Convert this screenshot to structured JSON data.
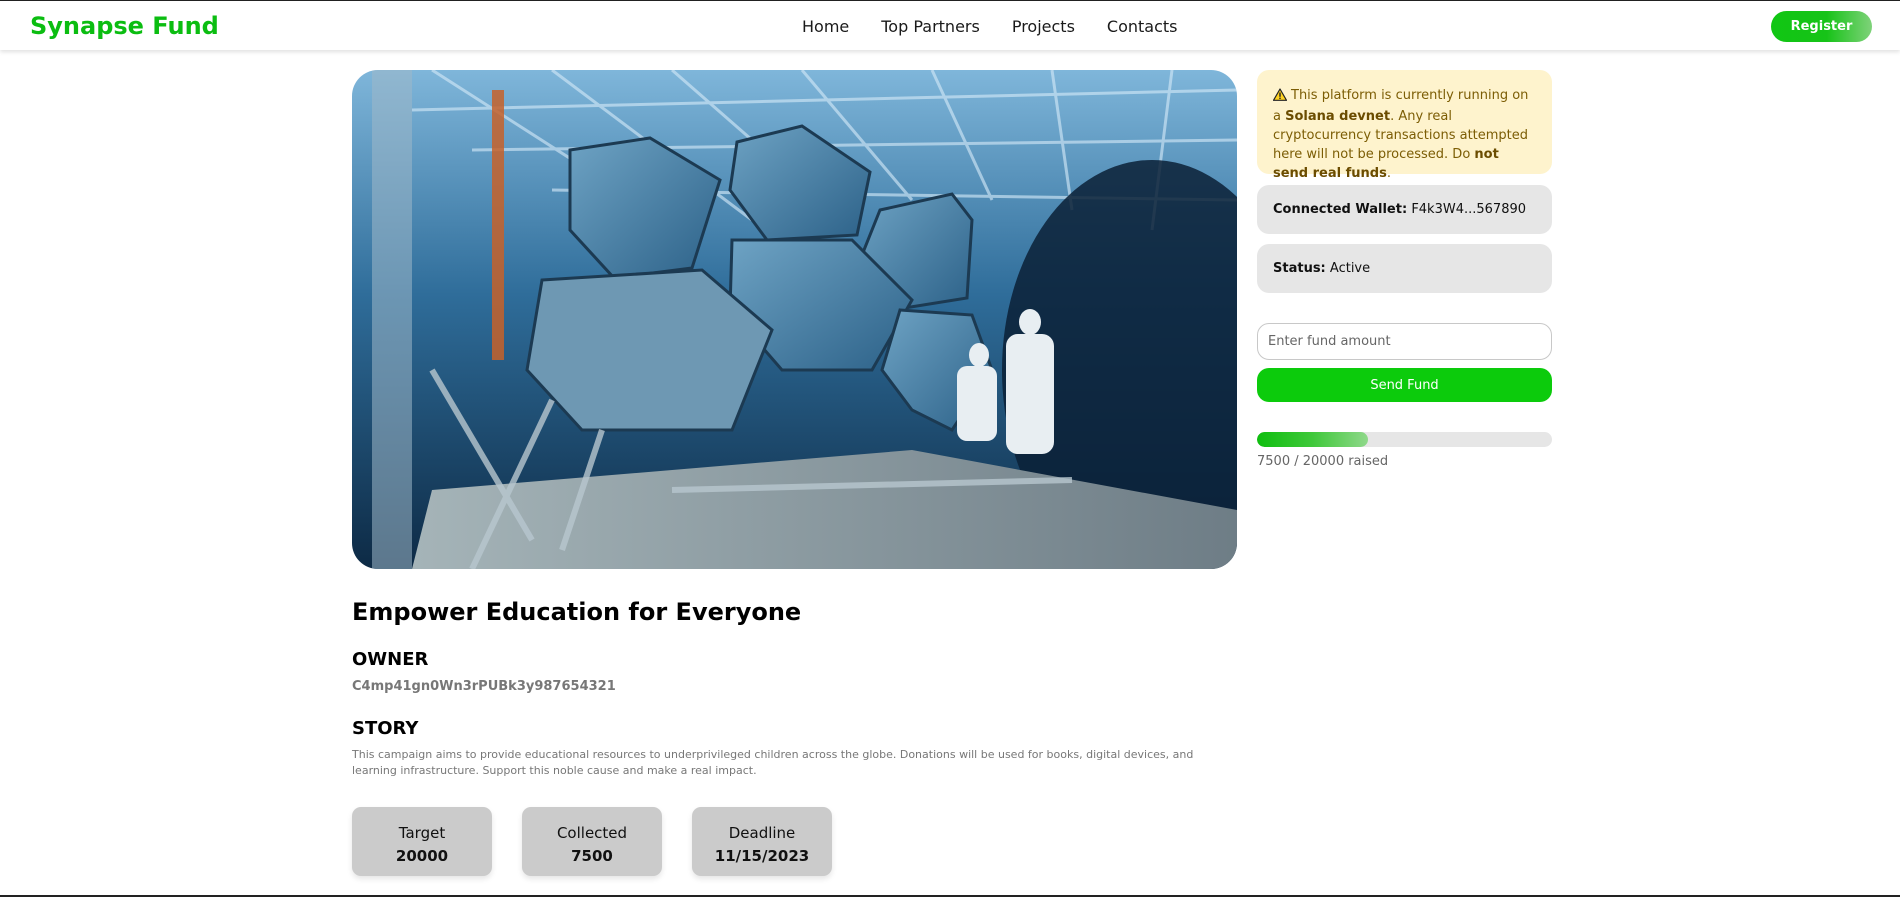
{
  "navbar": {
    "brand": "Synapse Fund",
    "links": [
      "Home",
      "Top Partners",
      "Projects",
      "Contacts"
    ],
    "register_label": "Register"
  },
  "project": {
    "title": "Empower Education for Everyone",
    "owner_heading": "OWNER",
    "owner": "C4mp41gn0Wn3rPUBk3y987654321",
    "story_heading": "STORY",
    "story": "This campaign aims to provide educational resources to underprivileged children across the globe. Donations will be used for books, digital devices, and learning infrastructure. Support this noble cause and make a real impact.",
    "stats": [
      {
        "label": "Target",
        "value": "20000"
      },
      {
        "label": "Collected",
        "value": "7500"
      },
      {
        "label": "Deadline",
        "value": "11/15/2023"
      }
    ]
  },
  "sidebar": {
    "warning": {
      "pre": "This platform is currently running on a ",
      "network": "Solana devnet",
      "mid": ". Any real cryptocurrency transactions attempted here will not be processed. Do ",
      "emphasis": "not send real funds",
      "post": "."
    },
    "wallet_key": "Connected Wallet:",
    "wallet_value": "F4k3W4...567890",
    "status_key": "Status:",
    "status_value": "Active",
    "fund_placeholder": "Enter fund amount",
    "send_label": "Send Fund",
    "progress_fraction": 0.375,
    "progress_text": "7500 / 20000 raised"
  },
  "colors": {
    "brand": "#0bbd11",
    "send_button": "#0ccb0c",
    "warning_bg": "#fef3cd",
    "card_bg": "#cbcbcb"
  },
  "icons": {
    "warning": "warning-triangle-icon"
  }
}
